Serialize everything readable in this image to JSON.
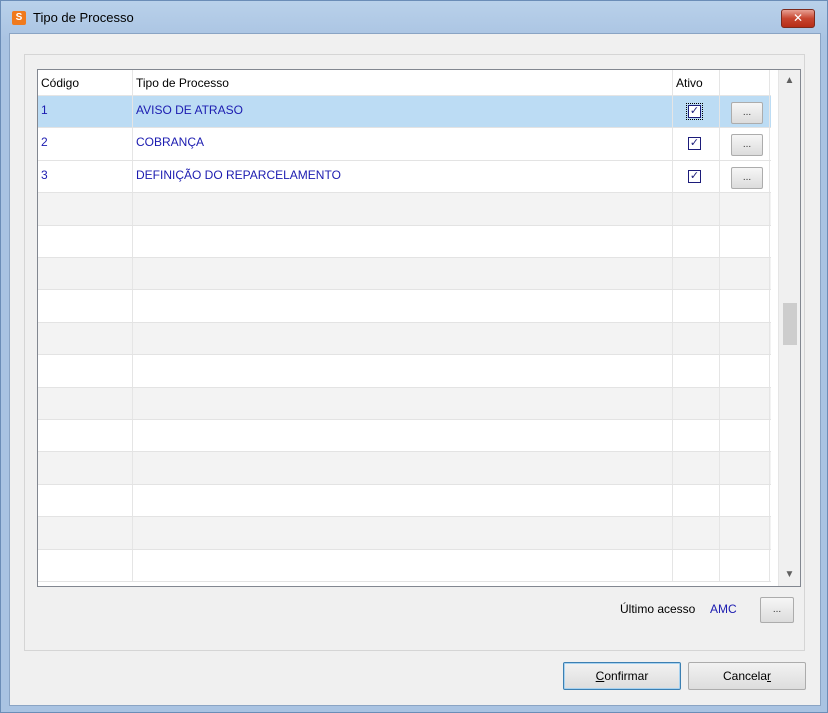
{
  "window": {
    "title": "Tipo de Processo",
    "close_glyph": "✕"
  },
  "grid": {
    "headers": {
      "codigo": "Código",
      "tipo": "Tipo de Processo",
      "ativo": "Ativo"
    },
    "rows": [
      {
        "codigo": "1",
        "tipo": "AVISO DE ATRASO",
        "ativo": true,
        "selected": true
      },
      {
        "codigo": "2",
        "tipo": "COBRANÇA",
        "ativo": true,
        "selected": false
      },
      {
        "codigo": "3",
        "tipo": "DEFINIÇÃO DO REPARCELAMENTO",
        "ativo": true,
        "selected": false
      }
    ],
    "row_button_label": "...",
    "check_glyph": "✓",
    "scroll_up_glyph": "▲",
    "scroll_down_glyph": "▼"
  },
  "footer": {
    "last_access_label": "Último acesso",
    "last_access_value": "AMC",
    "last_access_button": "..."
  },
  "buttons": {
    "confirm_first": "C",
    "confirm_rest": "onfirmar",
    "cancel_main": "Cancela",
    "cancel_underlined": "r"
  },
  "icons": {
    "app": "app-logo-icon"
  }
}
